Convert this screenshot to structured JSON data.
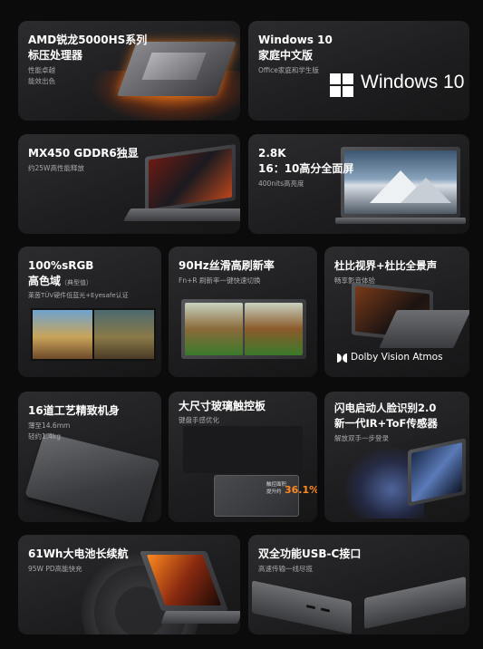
{
  "cards": {
    "cpu": {
      "title1": "AMD锐龙5000HS系列",
      "title2": "标压处理器",
      "sub1": "性能卓越",
      "sub2": "能效出色"
    },
    "os": {
      "title1": "Windows 10",
      "title2": "家庭中文版",
      "sub": "Office家庭和学生版",
      "logo_text": "Windows 10"
    },
    "gpu": {
      "title": "MX450 GDDR6独显",
      "sub": "约25W高性能释放"
    },
    "screen": {
      "title1": "2.8K",
      "title2": "16：10高分全面屏",
      "sub": "400nits高亮度"
    },
    "color": {
      "title1": "100%sRGB",
      "title2": "高色域",
      "title2_note": "（典型值）",
      "sub": "莱茵TÜV硬件低蓝光+Eyesafe认证"
    },
    "refresh": {
      "title": "90Hz丝滑高刷新率",
      "sub": "Fn+R 刷新率一键快速切换"
    },
    "dolby": {
      "title": "杜比视界+杜比全景声",
      "sub": "畅享影音体验",
      "logo_text": "Dolby Vision Atmos"
    },
    "body": {
      "title": "16道工艺精致机身",
      "sub1": "薄至14.6mm",
      "sub2": "轻约1.4kg"
    },
    "touchpad": {
      "title": "大尺寸玻璃触控板",
      "sub": "键盘手感优化",
      "label1": "触控面积",
      "label2": "提升约",
      "percent": "36.1%"
    },
    "face": {
      "title1": "闪电启动人脸识别2.0",
      "title2": "新一代IR+ToF传感器",
      "sub": "解放双手一步登录"
    },
    "battery": {
      "title": "61Wh大电池长续航",
      "sub": "95W PD高能快充"
    },
    "usbc": {
      "title": "双全功能USB-C接口",
      "sub": "高速传输一线尽揽"
    }
  },
  "colors": {
    "background": "#0b0b0c",
    "card": "#242427",
    "accent_orange": "#ff8a1f",
    "subtext": "#a9a9ae"
  }
}
